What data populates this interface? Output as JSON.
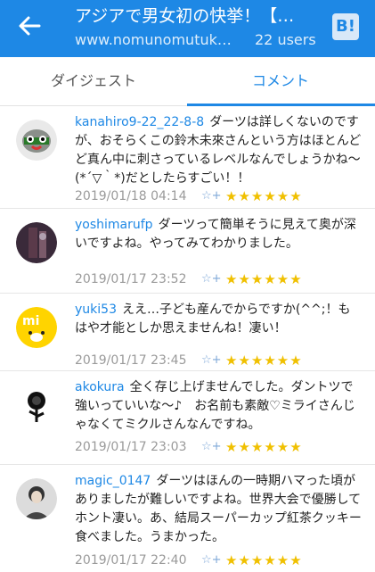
{
  "header": {
    "title": "アジアで男女初の快挙！【…",
    "domain": "www.nomunomutuk…",
    "users": "22 users",
    "hatena_label": "B!"
  },
  "tabs": [
    {
      "label": "ダイジェスト",
      "active": false
    },
    {
      "label": "コメント",
      "active": true
    }
  ],
  "star_glyphs": "★★★★★★",
  "star_add": "☆+",
  "comments": [
    {
      "user": "kanahiro9-22_22-8-8",
      "text": "ダーツは詳しくないのですが、おそらくこの鈴木未來さんという方はほとんどど真ん中に刺さっているレベルなんでしょうかね〜(*´▽｀*)だとしたらすごい！！",
      "date": "2019/01/18 04:14"
    },
    {
      "user": "yoshimarufp",
      "text": "ダーツって簡単そうに見えて奥が深いですよね。やってみてわかりました。",
      "date": "2019/01/17 23:52"
    },
    {
      "user": "yuki53",
      "text": "ええ…子ども産んでからですか(^^;！もはや才能としか思えませんね！凄い！",
      "date": "2019/01/17 23:45"
    },
    {
      "user": "akokura",
      "text": "全く存じ上げませんでした。ダントツで強いっていいな〜♪　お名前も素敵♡ミライさんじゃなくてミクルさんなんですね。",
      "date": "2019/01/17 23:03"
    },
    {
      "user": "magic_0147",
      "text": "ダーツはほんの一時期ハマった頃がありましたが難しいですよね。世界大会で優勝してホント凄い。あ、結局スーパーカップ紅茶クッキー食べました。うまかった。",
      "date": "2019/01/17 22:40"
    }
  ],
  "colors": {
    "accent": "#1e88e5",
    "star": "#f0c000"
  }
}
